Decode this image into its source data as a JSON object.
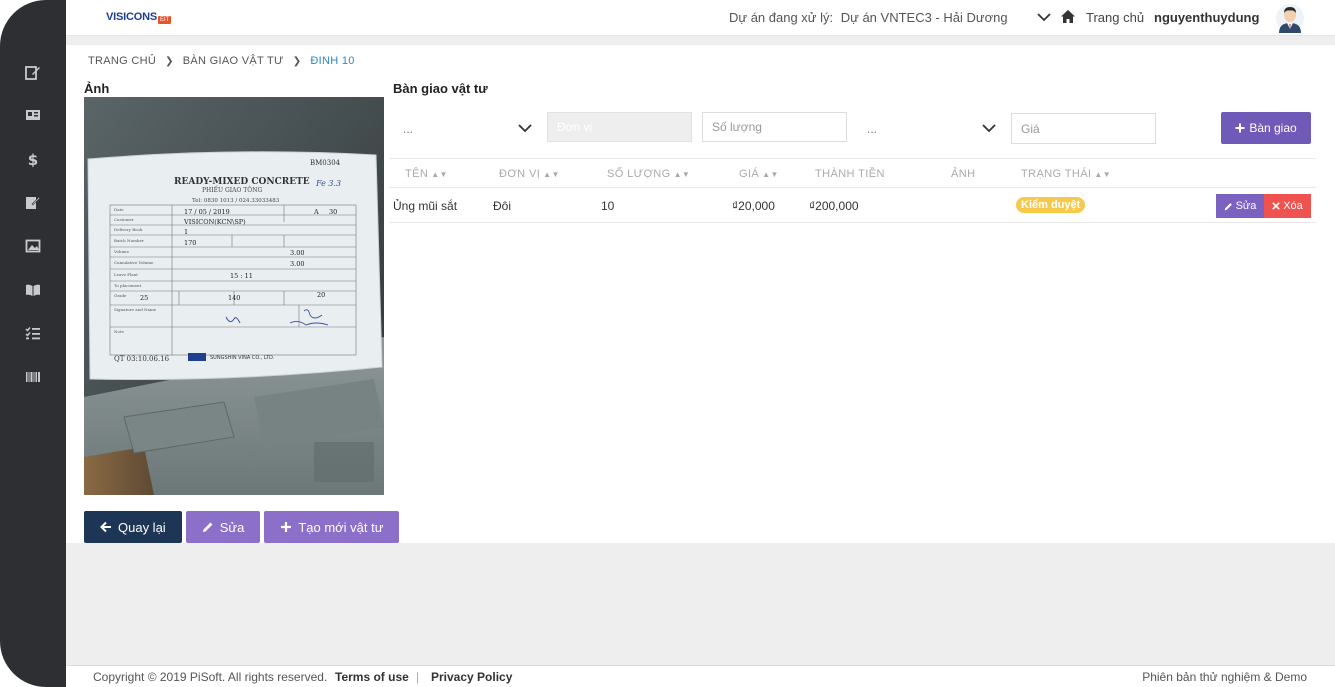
{
  "brand": {
    "logo_text": "VISICONS",
    "logo_badge": "EIT",
    "accent": "#6f5bb7"
  },
  "topbar": {
    "project_label": "Dự án đang xử lý:",
    "project_value": "Dự án VNTEC3 - Hải Dương",
    "home_label": "Trang chủ",
    "username": "nguyenthuydung"
  },
  "sidebar": {
    "items": [
      "edit-icon",
      "id-card-icon",
      "dollar-icon",
      "edit-note-icon",
      "image-icon",
      "book-icon",
      "checklist-icon",
      "barcode-icon"
    ]
  },
  "breadcrumb": [
    "TRANG CHỦ",
    "BÀN GIAO VẬT TƯ",
    "ĐINH 10"
  ],
  "photo_section": {
    "title": "Ảnh"
  },
  "photo_doc": {
    "code": "BM0304",
    "title": "READY-MIXED CONCRETE",
    "subtitle": "PHIẾU GIAO TÔNG",
    "tel": "Tel: 0830 1013 / 024.33033483",
    "date": "17 / 05 / 2019",
    "customer": "VISICON(KCN\\SP)",
    "one": "1",
    "num": "170",
    "vol1": "3.00",
    "vol2": "3.00",
    "time": "15 : 11",
    "grade": "25",
    "slump": "140",
    "agg": "20",
    "form_code": "QT 03:10.06.16",
    "company": "SUNGSHIN VINA CO., LTD."
  },
  "buttons": {
    "back": "Quay lại",
    "edit": "Sửa",
    "create": "Tạo mới vật tư"
  },
  "handover": {
    "title": "Bàn giao vật tư",
    "select1": "...",
    "unit_placeholder": "Đơn vị",
    "qty_placeholder": "Số lượng",
    "select2": "...",
    "price_placeholder": "Giá",
    "submit": "Bàn giao"
  },
  "table": {
    "headers": [
      "TÊN",
      "ĐƠN VỊ",
      "SỐ LƯỢNG",
      "GIÁ",
      "THÀNH TIỀN",
      "ẢNH",
      "TRẠNG THÁI"
    ],
    "rows": [
      {
        "name": "Ủng mũi sắt",
        "unit": "Đôi",
        "qty": "10",
        "price": "₫20,000",
        "total": "₫200,000",
        "status": "Kiểm duyệt",
        "edit": "Sửa",
        "delete": "Xóa"
      }
    ]
  },
  "footer": {
    "copyright": "Copyright © 2019 PiSoft. All rights reserved.",
    "terms": "Terms of use",
    "separator": "|",
    "privacy": "Privacy Policy",
    "version": "Phiên bản thử nghiệm & Demo"
  }
}
